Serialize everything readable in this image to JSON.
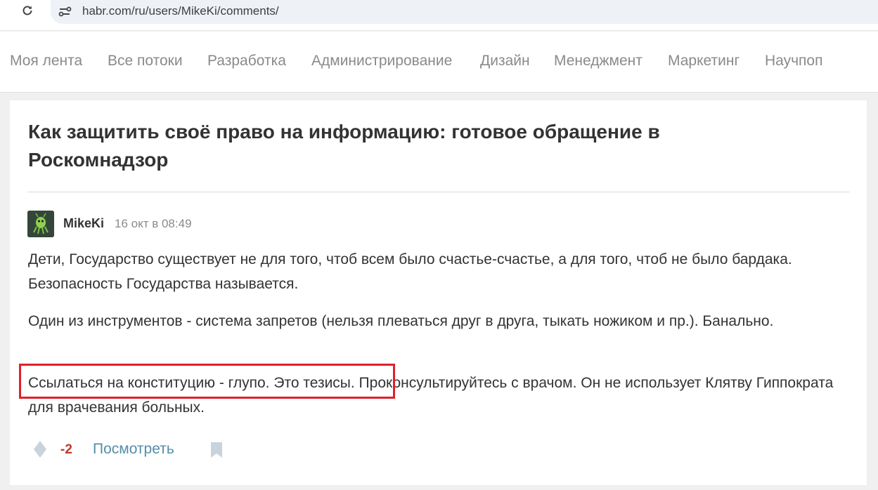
{
  "browser": {
    "url": "habr.com/ru/users/MikeKi/comments/"
  },
  "nav": {
    "items": [
      "Моя лента",
      "Все потоки",
      "Разработка",
      "Администрирование",
      "Дизайн",
      "Менеджмент",
      "Маркетинг",
      "Научпоп"
    ]
  },
  "article": {
    "title": "Как защитить своё право на информацию: готовое обращение в Роскомнадзор"
  },
  "comment": {
    "author": "MikeKi",
    "timestamp": "16 окт в 08:49",
    "paragraphs": [
      "Дети, Государство существует не для того, чтоб всем было счастье-счастье, а для того, чтоб не было бардака. Безопасность Государства называется.",
      "Один из инструментов - система запретов (нельзя плеваться друг в друга, тыкать ножиком и пр.). Банально.",
      "Ссылаться на конституцию - глупо. Это тезисы. Проконсультируйтесь с врачом. Он не использует Клятву Гиппократа для врачевания больных."
    ],
    "score": "-2",
    "view_label": "Посмотреть"
  },
  "icons": {
    "reload": "reload-icon",
    "site_info": "site-info-icon",
    "vote": "vote-icon",
    "bookmark": "bookmark-icon"
  },
  "colors": {
    "highlight": "#e0202a",
    "score_negative": "#c0392b",
    "link": "#548eaa"
  }
}
